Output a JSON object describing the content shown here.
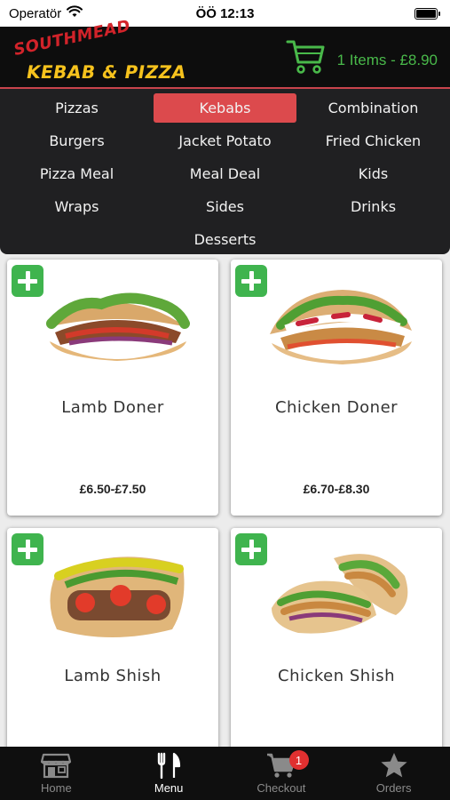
{
  "status_bar": {
    "carrier": "Operatör",
    "time": "ÖÖ 12:13"
  },
  "brand": {
    "line1": "SOUTHMEAD",
    "line2": "KEBAB & PIZZA"
  },
  "cart": {
    "summary": "1 Items - £8.90"
  },
  "categories": [
    {
      "label": "Pizzas",
      "active": false
    },
    {
      "label": "Kebabs",
      "active": true
    },
    {
      "label": "Combination",
      "active": false
    },
    {
      "label": "Burgers",
      "active": false
    },
    {
      "label": "Jacket Potato",
      "active": false
    },
    {
      "label": "Fried Chicken",
      "active": false
    },
    {
      "label": "Pizza Meal",
      "active": false
    },
    {
      "label": "Meal Deal",
      "active": false
    },
    {
      "label": "Kids",
      "active": false
    },
    {
      "label": "Wraps",
      "active": false
    },
    {
      "label": "Sides",
      "active": false
    },
    {
      "label": "Drinks",
      "active": false
    },
    {
      "label": "Desserts",
      "active": false
    }
  ],
  "products": [
    {
      "name": "Lamb Doner",
      "price": "£6.50-£7.50"
    },
    {
      "name": "Chicken Doner",
      "price": "£6.70-£8.30"
    },
    {
      "name": "Lamb Shish",
      "price": ""
    },
    {
      "name": "Chicken Shish",
      "price": ""
    }
  ],
  "tabs": [
    {
      "label": "Home",
      "icon": "store-icon",
      "active": false
    },
    {
      "label": "Menu",
      "icon": "cutlery-icon",
      "active": true
    },
    {
      "label": "Checkout",
      "icon": "cart-icon",
      "active": false,
      "badge": "1"
    },
    {
      "label": "Orders",
      "icon": "star-icon",
      "active": false
    }
  ],
  "colors": {
    "accent": "#dc4a4d",
    "add_button": "#3fb44e",
    "cart_text": "#49b94a",
    "header_bg": "#0d0d0d"
  }
}
